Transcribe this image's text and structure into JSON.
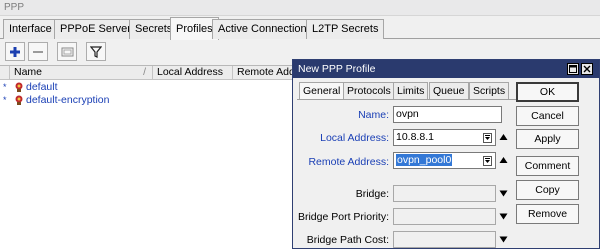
{
  "window": {
    "title": "PPP"
  },
  "tabs": [
    {
      "label": "Interface"
    },
    {
      "label": "PPPoE Servers"
    },
    {
      "label": "Secrets"
    },
    {
      "label": "Profiles"
    },
    {
      "label": "Active Connections"
    },
    {
      "label": "L2TP Secrets"
    }
  ],
  "active_tab": "Profiles",
  "toolbar": {
    "icons": [
      "plus-icon",
      "minus-icon",
      "comment-icon",
      "filter-icon"
    ]
  },
  "list": {
    "columns": [
      "Name",
      "Local Address",
      "Remote Addr"
    ],
    "sort_marker": "/",
    "rows": [
      {
        "flag": "*",
        "name": "default"
      },
      {
        "flag": "*",
        "name": "default-encryption"
      }
    ]
  },
  "dialog": {
    "title": "New PPP Profile",
    "tabs": [
      "General",
      "Protocols",
      "Limits",
      "Queue",
      "Scripts"
    ],
    "active_tab": "General",
    "fields": {
      "name": {
        "label": "Name:",
        "value": "ovpn"
      },
      "local_address": {
        "label": "Local Address:",
        "value": "10.8.8.1"
      },
      "remote_address": {
        "label": "Remote Address:",
        "value": "ovpn_pool0"
      },
      "bridge": {
        "label": "Bridge:",
        "value": ""
      },
      "bridge_port_priority": {
        "label": "Bridge Port Priority:",
        "value": ""
      },
      "bridge_path_cost": {
        "label": "Bridge Path Cost:",
        "value": ""
      }
    },
    "buttons": {
      "ok": "OK",
      "cancel": "Cancel",
      "apply": "Apply",
      "comment": "Comment",
      "copy": "Copy",
      "remove": "Remove"
    }
  }
}
